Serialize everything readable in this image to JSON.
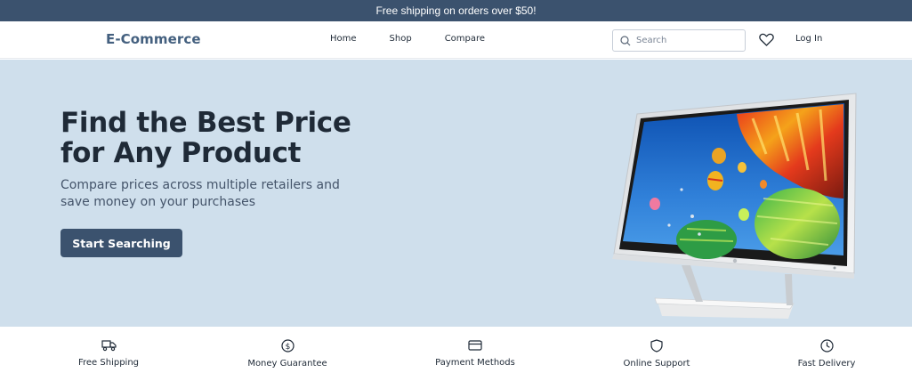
{
  "announcement": "Free shipping on orders over $50!",
  "brand": "E-Commerce",
  "nav": {
    "links": [
      "Home",
      "Shop",
      "Compare"
    ],
    "search_placeholder": "Search",
    "login": "Log In"
  },
  "hero": {
    "headline": "Find the Best Price for Any Product",
    "subtext": "Compare prices across multiple retailers and save money on your purchases",
    "cta": "Start Searching"
  },
  "features": [
    {
      "label": "Free Shipping",
      "icon": "truck-icon"
    },
    {
      "label": "Money Guarantee",
      "icon": "dollar-circle-icon"
    },
    {
      "label": "Payment Methods",
      "icon": "credit-card-icon"
    },
    {
      "label": "Online Support",
      "icon": "shield-icon"
    },
    {
      "label": "Fast Delivery",
      "icon": "clock-icon"
    }
  ],
  "colors": {
    "topbar": "#3b526e",
    "hero_bg": "#cfdfec",
    "brand": "#44607f",
    "button": "#3b526e"
  }
}
